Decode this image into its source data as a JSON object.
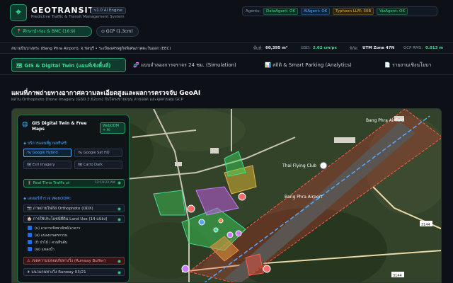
{
  "app": {
    "brand_prefix": "GEOTRANSIT",
    "brand_suffix": "X",
    "version": "v1.0 AI Engine",
    "subtitle": "Predictive Traffic & Transit Management System",
    "agents_label": "Agents:",
    "agents": [
      {
        "label": "DataAgent: OK",
        "color": "green"
      },
      {
        "label": "AIAgent: OK",
        "color": "blue"
      },
      {
        "label": "Typhoon LLM: 30B",
        "color": "blue"
      },
      {
        "label": "VizAgent: OK",
        "color": "green"
      }
    ],
    "buttons": {
      "location_btn": "📍 ศึกษานำร่อง & BMC (16:9)",
      "gcp_btn": "⊙ GCP (1.3cm)"
    }
  },
  "location": {
    "name": "สนามบินบางพระ (Bang Phra Airport), จ.ชลบุรี • ระเบียงเศรษฐกิจพิเศษภาคตะวันออก (EEC)",
    "area_label": "พื้นที่:",
    "area_value": "60,395 m²",
    "gsd_label": "GSD:",
    "gsd_value": "2.62 cm/px",
    "crs_label": "พิกัด:",
    "crs_value": "UTM Zone 47N",
    "gcp_label": "GCP RMS:",
    "gcp_value": "0.013 m"
  },
  "tabs": [
    {
      "label": "🗺 GIS & Digital Twin (แผนที่เชิงพื้นที่)",
      "active": true
    },
    {
      "label": "🧬 แบบจำลองการจราจร 24 ชม. (Simulation)",
      "active": false
    },
    {
      "label": "📊 สถิติ & Smart Parking (Analytics)",
      "active": false
    },
    {
      "label": "📄 รายงานเชิงนโยบา",
      "active": false
    }
  ],
  "page": {
    "title": "แผนที่ภาพถ่ายทางอากาศความละเอียดสูงและผลการตรวจจับ GeoAI",
    "subtitle": "ผสาน Orthophoto Drone Imagery (GSD 2.62cm) กับโครงข่ายถนน ลานจอด และจุดควบคุม GCP"
  },
  "panel": {
    "title": "GIS Digital Twin & Free Maps",
    "badge": "WebODM + AI",
    "basemap_heading": "◈ บริการแผนที่ฐานฟรีเสรี:",
    "basemaps": [
      {
        "label": "🛰 Google Hybrid",
        "active": true
      },
      {
        "label": "🛰 Google Sat HD",
        "active": false
      },
      {
        "label": "🗺 Esri Imagery",
        "active": false
      },
      {
        "label": "🗺 Carto Dark",
        "active": false
      }
    ],
    "traffic_label": "🚦 Real-Time Traffic ⇄",
    "traffic_time": "12:19:22 AM",
    "webodm_heading": "◈ เลเยอร์สำรวจ WebODM:",
    "orthophoto": "📷 ภาพถ่ายโฟกัส Orthophoto (ODX)",
    "landuse": "🏠 การใช้ประโยชน์ที่ดิน Land Use (14 แปลง)",
    "landuse_items": [
      "(u) อาคารเชิงพาณิชย์/อาคาร",
      "(a) แปลงเกษตรกรรม",
      "(f) ป่าไม้ / สวนยืนต้น",
      "(w) แหล่งน้ำ"
    ],
    "runway_buffer": "⚠ เขตความปลอดภัยทางวิ่ง (Runway Buffer)",
    "runway_line": "✈ แนวแกนทางวิ่ง Runway 03/21"
  },
  "map": {
    "labels": {
      "road_tag": "3144",
      "road_tag2": "3144",
      "poi1": "Thai Flying Club",
      "poi2": "Bang Phra Airport",
      "poi3": "Bang Phra Airfield"
    }
  }
}
